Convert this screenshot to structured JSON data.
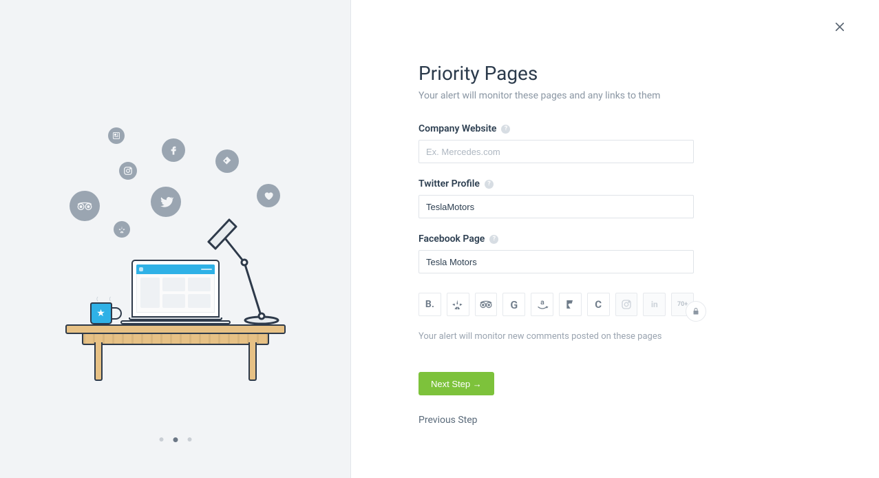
{
  "title": "Priority Pages",
  "subtitle": "Your alert will monitor these pages and any links to them",
  "fields": {
    "company_website": {
      "label": "Company Website",
      "placeholder": "Ex. Mercedes.com",
      "value": ""
    },
    "twitter_profile": {
      "label": "Twitter Profile",
      "placeholder": "",
      "value": "TeslaMotors"
    },
    "facebook_page": {
      "label": "Facebook Page",
      "placeholder": "",
      "value": "Tesla Motors"
    }
  },
  "sources": {
    "items": [
      {
        "name": "booking",
        "label": "B.",
        "enabled": true
      },
      {
        "name": "yelp",
        "label": "",
        "enabled": true
      },
      {
        "name": "tripadvisor",
        "label": "",
        "enabled": true
      },
      {
        "name": "google",
        "label": "G",
        "enabled": true
      },
      {
        "name": "amazon",
        "label": "a",
        "enabled": true
      },
      {
        "name": "foursquare",
        "label": "",
        "enabled": true
      },
      {
        "name": "capterra",
        "label": "C",
        "enabled": true
      },
      {
        "name": "instagram",
        "label": "",
        "enabled": false
      },
      {
        "name": "linkedin",
        "label": "in",
        "enabled": false
      }
    ],
    "more_label": "70+",
    "locked": true
  },
  "hint": "Your alert will monitor new comments posted on these pages",
  "actions": {
    "next_label": "Next Step →",
    "prev_label": "Previous Step"
  },
  "carousel": {
    "total": 3,
    "active_index": 1
  },
  "colors": {
    "accent_green": "#7dc23b",
    "accent_blue": "#2fb1e6",
    "panel_bg": "#f2f4f6"
  }
}
